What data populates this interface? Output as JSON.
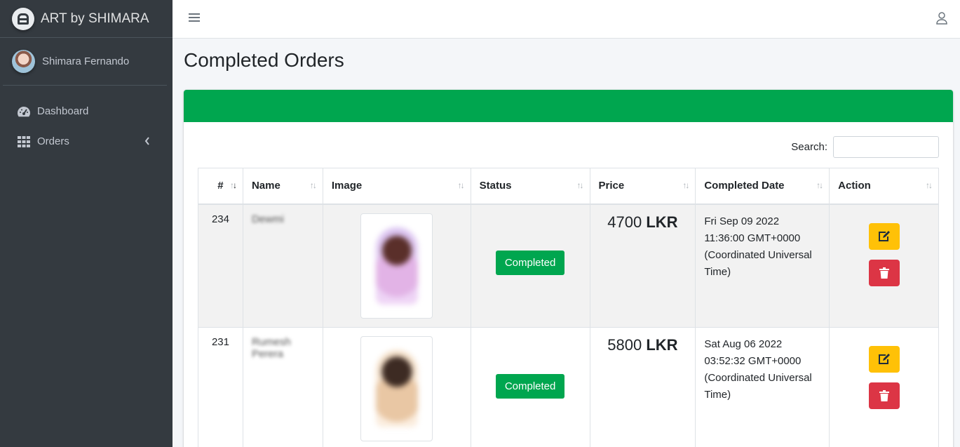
{
  "brand": {
    "name": "ART by SHIMARA"
  },
  "user": {
    "name": "Shimara Fernando"
  },
  "sidebar": {
    "items": [
      {
        "label": "Dashboard",
        "icon": "tachometer-icon"
      },
      {
        "label": "Orders",
        "icon": "grid-icon"
      }
    ]
  },
  "page": {
    "title": "Completed Orders"
  },
  "search": {
    "label": "Search:",
    "value": ""
  },
  "table": {
    "headers": [
      "#",
      "Name",
      "Image",
      "Status",
      "Price",
      "Completed Date",
      "Action"
    ],
    "rows": [
      {
        "id": "234",
        "name": "Dewmi",
        "status": "Completed",
        "price_amount": "4700",
        "price_currency": "LKR",
        "completed_date": "Fri Sep 09 2022 11:36:00 GMT+0000 (Coordinated Universal Time)"
      },
      {
        "id": "231",
        "name": "Rumesh Perera",
        "status": "Completed",
        "price_amount": "5800",
        "price_currency": "LKR",
        "completed_date": "Sat Aug 06 2022 03:52:32 GMT+0000 (Coordinated Universal Time)"
      }
    ]
  },
  "colors": {
    "sidebar_bg": "#343a40",
    "card_header": "#00a64f",
    "badge": "#00a64f",
    "edit_button": "#ffc107",
    "delete_button": "#dc3545"
  }
}
